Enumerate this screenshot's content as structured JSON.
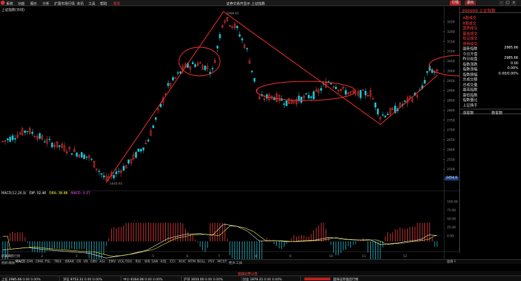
{
  "menubar": {
    "items": [
      "系统",
      "功能",
      "报价",
      "分析",
      "扩展市场行情",
      "资讯",
      "工具",
      "帮助",
      "发现"
    ],
    "title": "证券交易开显示  上证指数",
    "market_button": "退出",
    "market_button2": "行情"
  },
  "chart": {
    "header": "上证指数(日线)",
    "high_label": "3288.45",
    "low_label": "2440.91",
    "y_ticks": [
      "3250",
      "3200",
      "3150",
      "3100",
      "3050",
      "3000",
      "2950",
      "2900",
      "2850",
      "2800",
      "2750",
      "2700",
      "2650",
      "2600",
      "2550",
      "2500",
      "2450"
    ],
    "price_tag": "2454.6",
    "x_ticks": [
      "2016年",
      "2",
      "3",
      "4",
      "5",
      "6",
      "7",
      "8",
      "9",
      "10",
      "11",
      "12"
    ]
  },
  "macd": {
    "header_name": "MACD(12,26,9)",
    "dif_label": "DIF: 32.40",
    "dea_label": "DEA: 38.88",
    "macd_label": "MACD: 0.37",
    "y_ticks": [
      "100.00",
      "75.00",
      "50.00",
      "25.00",
      "0.00"
    ],
    "panel_tag": "扩展市场行情"
  },
  "panel": {
    "title": "999999 上证指数",
    "rows": [
      {
        "label": "A股成交",
        "value": ""
      },
      {
        "label": "B股成交",
        "value": ""
      },
      {
        "label": "国债成交",
        "value": ""
      },
      {
        "label": "基金成交",
        "value": ""
      },
      {
        "label": "权证成交",
        "value": ""
      },
      {
        "label": "债券成交",
        "value": ""
      },
      {
        "label": "最新指数",
        "value": "2985.66"
      },
      {
        "label": "今日开盘",
        "value": ""
      },
      {
        "label": "昨日收盘",
        "value": "2985.66"
      },
      {
        "label": "指数涨跌",
        "value": "0.00"
      },
      {
        "label": "指数涨幅",
        "value": "0.00%"
      },
      {
        "label": "指数振幅",
        "value": "0.00/0.00%"
      },
      {
        "label": "总成交额",
        "value": ""
      },
      {
        "label": "总成交量",
        "value": ""
      },
      {
        "label": "最高指数",
        "value": ""
      },
      {
        "label": "最低指数",
        "value": ""
      },
      {
        "label": "指数量比",
        "value": ""
      },
      {
        "label": "上证换手",
        "value": ""
      }
    ],
    "up_count_label": "涨家数",
    "down_count_label": "跌家数"
  },
  "indicator_tabs": [
    "指标",
    "模板",
    "MACD",
    "DMI",
    "DMA",
    "FSL",
    "TRIX",
    "BRAR",
    "CR",
    "VR",
    "OBV",
    "ASI",
    "EMV",
    "VOL-TDX",
    "RSI",
    "WR",
    "SAR",
    "KDJ",
    "CCI",
    "ROC",
    "MTM",
    "BOLL",
    "PSY",
    "MCST",
    "更多",
    "工具"
  ],
  "scroll_info": "图像 F",
  "statusbar": {
    "items": [
      {
        "name": "上证",
        "value": "2985.66",
        "chg": "0.00",
        "pct": "0.00%"
      },
      {
        "name": "深证",
        "value": "9753.31",
        "chg": "0.00",
        "pct": "0.00%"
      },
      {
        "name": "中小",
        "value": "6164.06",
        "chg": "0.00",
        "pct": "0.00%"
      },
      {
        "name": "沪深",
        "value": "3010.00",
        "chg": "0.00",
        "pct": "0.00%"
      },
      {
        "name": "创业",
        "value": "1979.31",
        "chg": "0.00",
        "pct": "0.00%"
      }
    ],
    "news": "国海证券公告",
    "news2": "国海证券盘后行情"
  },
  "colors": {
    "up": "#ff3b3b",
    "down": "#1ec8d8",
    "annotation": "#ff3030",
    "dif": "#ffffff",
    "dea": "#ffff40"
  }
}
